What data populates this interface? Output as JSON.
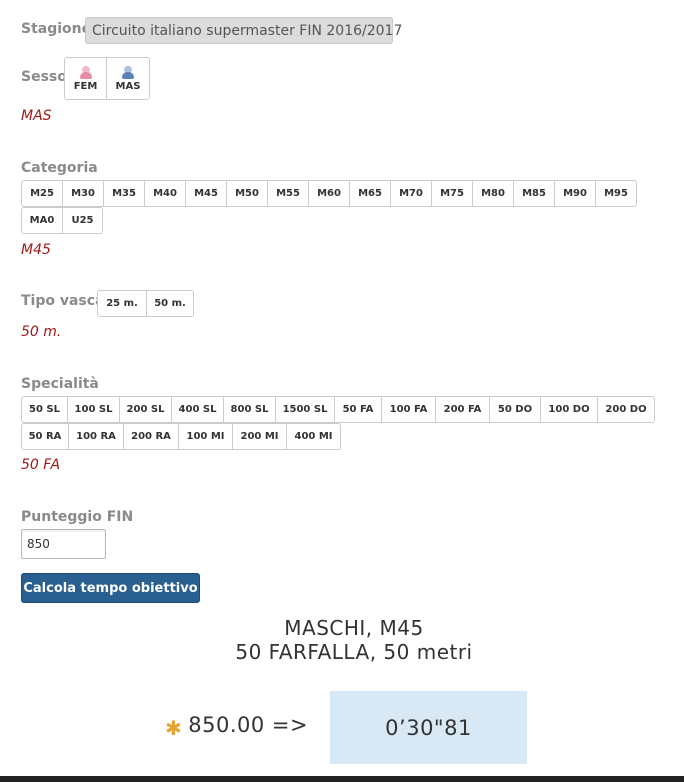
{
  "stagione": {
    "label": "Stagione",
    "value": "Circuito italiano supermaster FIN 2016/2017"
  },
  "sesso": {
    "label": "Sesso",
    "options": [
      {
        "label": "FEM",
        "icon": "female-icon",
        "color": "#e98aa6"
      },
      {
        "label": "MAS",
        "icon": "male-icon",
        "color": "#5b82b8"
      }
    ],
    "selected": "MAS"
  },
  "categoria": {
    "label": "Categoria",
    "options": [
      "M25",
      "M30",
      "M35",
      "M40",
      "M45",
      "M50",
      "M55",
      "M60",
      "M65",
      "M70",
      "M75",
      "M80",
      "M85",
      "M90",
      "M95",
      "MA0",
      "U25"
    ],
    "selected": "M45"
  },
  "vasca": {
    "label": "Tipo vasca",
    "options": [
      "25 m.",
      "50 m."
    ],
    "selected": "50 m."
  },
  "specialita": {
    "label": "Specialità",
    "options": [
      "50 SL",
      "100 SL",
      "200 SL",
      "400 SL",
      "800 SL",
      "1500 SL",
      "50 FA",
      "100 FA",
      "200 FA",
      "50 DO",
      "100 DO",
      "200 DO",
      "50 RA",
      "100 RA",
      "200 RA",
      "100 MI",
      "200 MI",
      "400 MI"
    ],
    "selected": "50 FA"
  },
  "punteggio": {
    "label": "Punteggio FIN",
    "value": "850"
  },
  "calc_button": "Calcola tempo obiettivo",
  "result": {
    "line1": "MASCHI, M45",
    "line2": "50 FARFALLA, 50 metri",
    "score": "850.00 =>",
    "time": "0’30\"81",
    "accent_color": "#e8a232",
    "time_bg": "#d8e9f5"
  }
}
